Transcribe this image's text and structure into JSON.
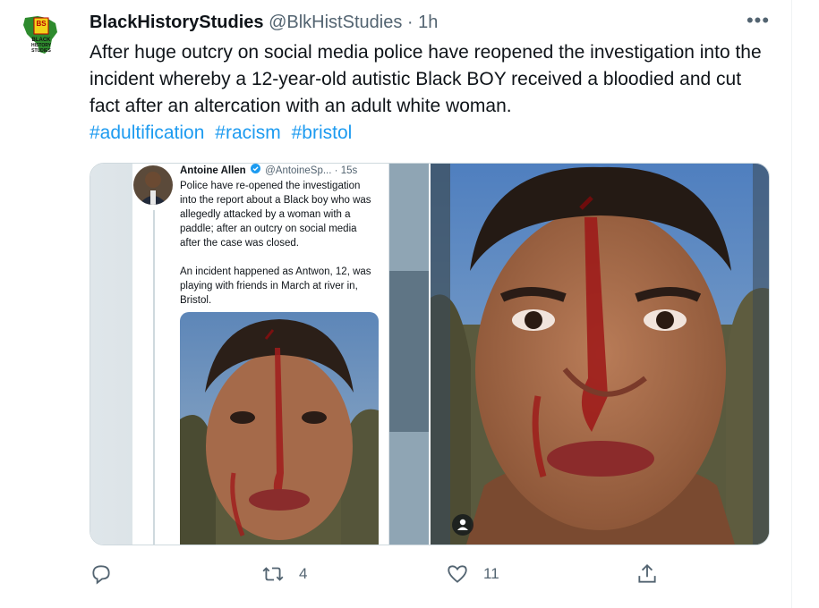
{
  "tweet": {
    "display_name": "BlackHistoryStudies",
    "handle": "@BlkHistStudies",
    "separator": "·",
    "time": "1h",
    "more_label": "•••",
    "text": "After huge outcry on social media police have reopened the investigation into the incident whereby a 12-year-old autistic Black BOY received a bloodied and cut fact after an altercation with an adult white woman.",
    "hashtags": [
      "#adultification",
      "#racism",
      "#bristol"
    ],
    "avatar_logo": {
      "line1": "BS",
      "line2": "BLACK",
      "line3": "HISTORY",
      "line4": "STUDIES"
    }
  },
  "embedded_screenshot": {
    "name": "Antoine Allen",
    "handle": "@AntoineSp...",
    "separator": "·",
    "time": "15s",
    "text": "Police have re-opened the investigation into the report about a Black boy who was allegedly attacked by a woman with a paddle; after an outcry on social media after the case was closed.\n\nAn incident happened as Antwon, 12, was playing with friends in March at river in, Bristol."
  },
  "actions": {
    "reply_count": "",
    "retweet_count": "4",
    "like_count": "11"
  },
  "colors": {
    "accent": "#1d9bf0",
    "secondary_text": "#536471",
    "primary_text": "#0f1419"
  },
  "icons": [
    "more-icon",
    "verified-icon",
    "reply-icon",
    "retweet-icon",
    "like-icon",
    "share-icon",
    "person-icon"
  ]
}
